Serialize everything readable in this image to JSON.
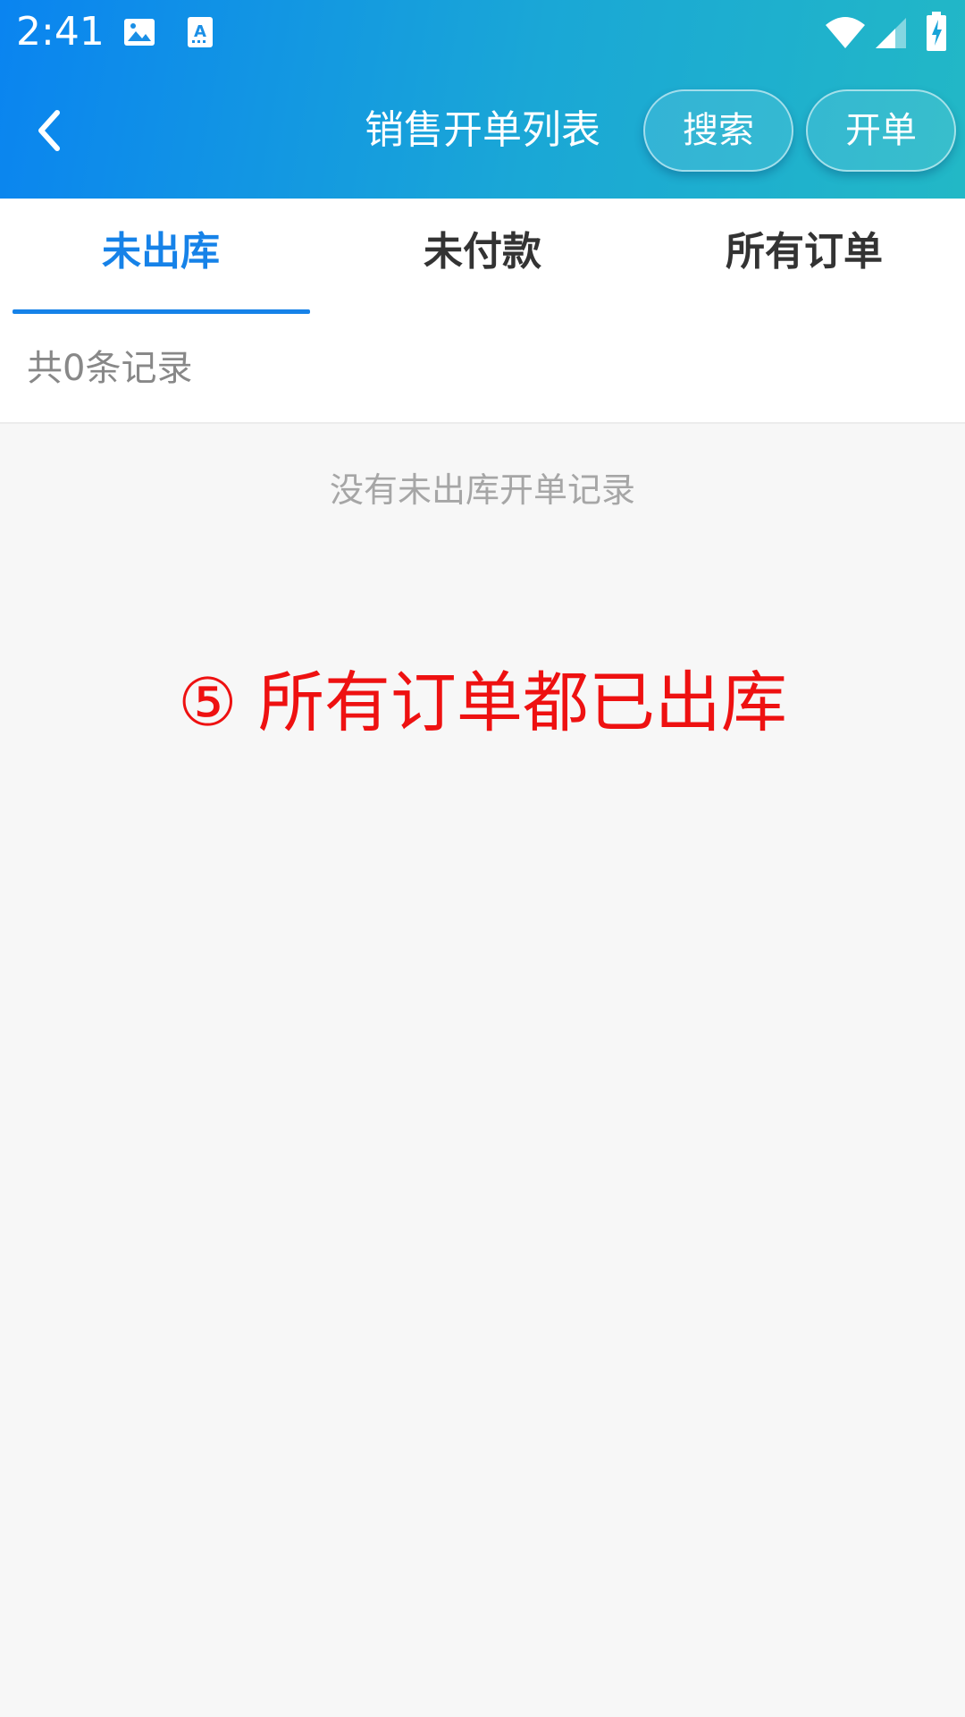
{
  "status_bar": {
    "time": "2:41",
    "icons": [
      "image-icon",
      "keyboard-a-icon",
      "wifi-icon",
      "cellular-signal-icon",
      "battery-charging-icon"
    ]
  },
  "navbar": {
    "title": "销售开单列表",
    "back_icon": "chevron-left-icon",
    "search_label": "搜索",
    "create_label": "开单"
  },
  "tabs": [
    {
      "label": "未出库",
      "active": true
    },
    {
      "label": "未付款",
      "active": false
    },
    {
      "label": "所有订单",
      "active": false
    }
  ],
  "list": {
    "count_text": "共0条记录",
    "empty_text": "没有未出库开单记录"
  },
  "annotation": {
    "text": "⑤ 所有订单都已出库",
    "color": "#ee1111"
  },
  "colors": {
    "header_gradient_start": "#0a84f0",
    "header_gradient_end": "#22b8c6",
    "tab_active": "#1682e8",
    "background": "#f7f7f7"
  }
}
